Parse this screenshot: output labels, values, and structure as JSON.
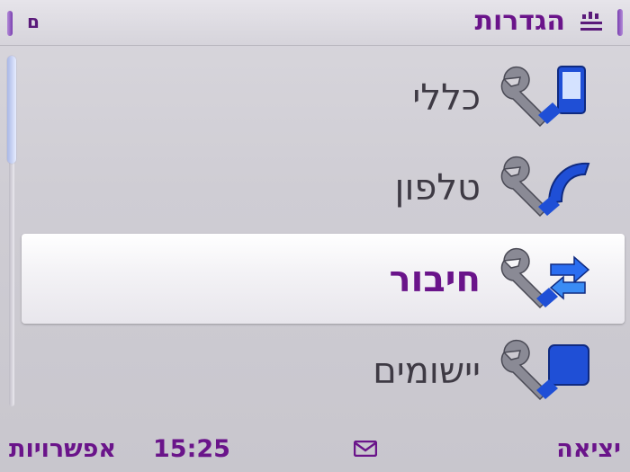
{
  "header": {
    "title": "הגדרות",
    "indicator": "ם",
    "app_icon": "settings-app-icon"
  },
  "menu": {
    "items": [
      {
        "label": "כללי",
        "icon": "general-settings-icon"
      },
      {
        "label": "טלפון",
        "icon": "phone-settings-icon"
      },
      {
        "label": "חיבור",
        "icon": "connection-settings-icon"
      },
      {
        "label": "יישומים",
        "icon": "applications-settings-icon"
      }
    ],
    "selected_index": 2
  },
  "footer": {
    "left_softkey": "אפשרויות",
    "clock": "15:25",
    "right_softkey": "יציאה",
    "message_icon": "envelope-icon"
  },
  "colors": {
    "accent": "#6a148a",
    "icon_blue": "#1f4fd6"
  }
}
